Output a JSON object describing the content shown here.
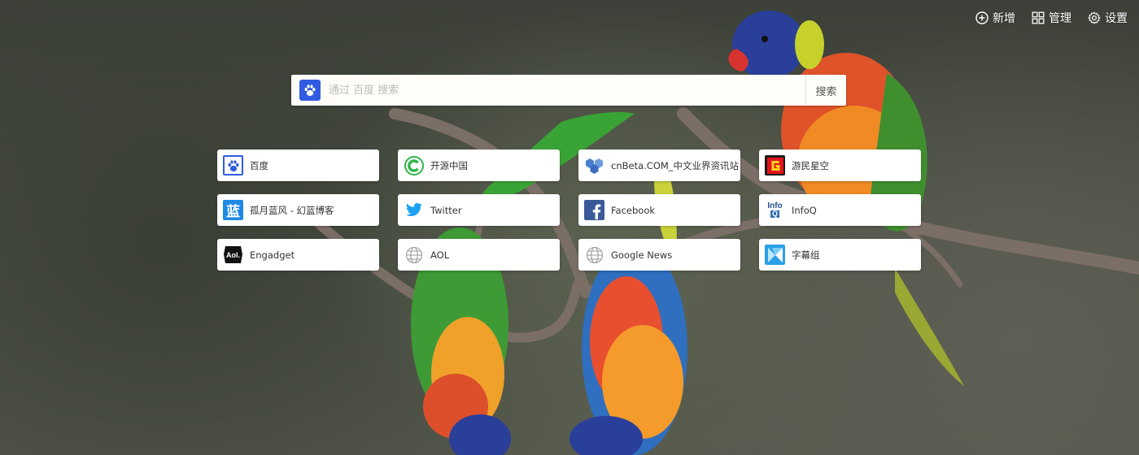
{
  "toolbar": {
    "add_label": "新增",
    "manage_label": "管理",
    "settings_label": "设置"
  },
  "search": {
    "placeholder": "通过 百度 搜索",
    "button_label": "搜索",
    "engine_icon": "baidu-paw-icon"
  },
  "tiles": [
    {
      "label": "百度",
      "icon": "baidu-paw-icon"
    },
    {
      "label": "开源中国",
      "icon": "oschina-icon"
    },
    {
      "label": "cnBeta.COM_中文业界资讯站",
      "icon": "cnbeta-icon"
    },
    {
      "label": "游民星空",
      "icon": "gamersky-icon"
    },
    {
      "label": "孤月蓝风 - 幻蓝博客",
      "icon": "lan-icon"
    },
    {
      "label": "Twitter",
      "icon": "twitter-icon"
    },
    {
      "label": "Facebook",
      "icon": "facebook-icon"
    },
    {
      "label": "InfoQ",
      "icon": "infoq-icon"
    },
    {
      "label": "Engadget",
      "icon": "aol-icon"
    },
    {
      "label": "AOL",
      "icon": "globe-icon"
    },
    {
      "label": "Google News",
      "icon": "globe-icon"
    },
    {
      "label": "字幕组",
      "icon": "zimuzu-icon"
    }
  ],
  "colors": {
    "baidu": "#2f5ce0",
    "oschina": "#2fb54a",
    "twitter": "#1da1f2",
    "facebook": "#3b5998",
    "gamersky": "#e0151b",
    "lan": "#1e88e5"
  }
}
